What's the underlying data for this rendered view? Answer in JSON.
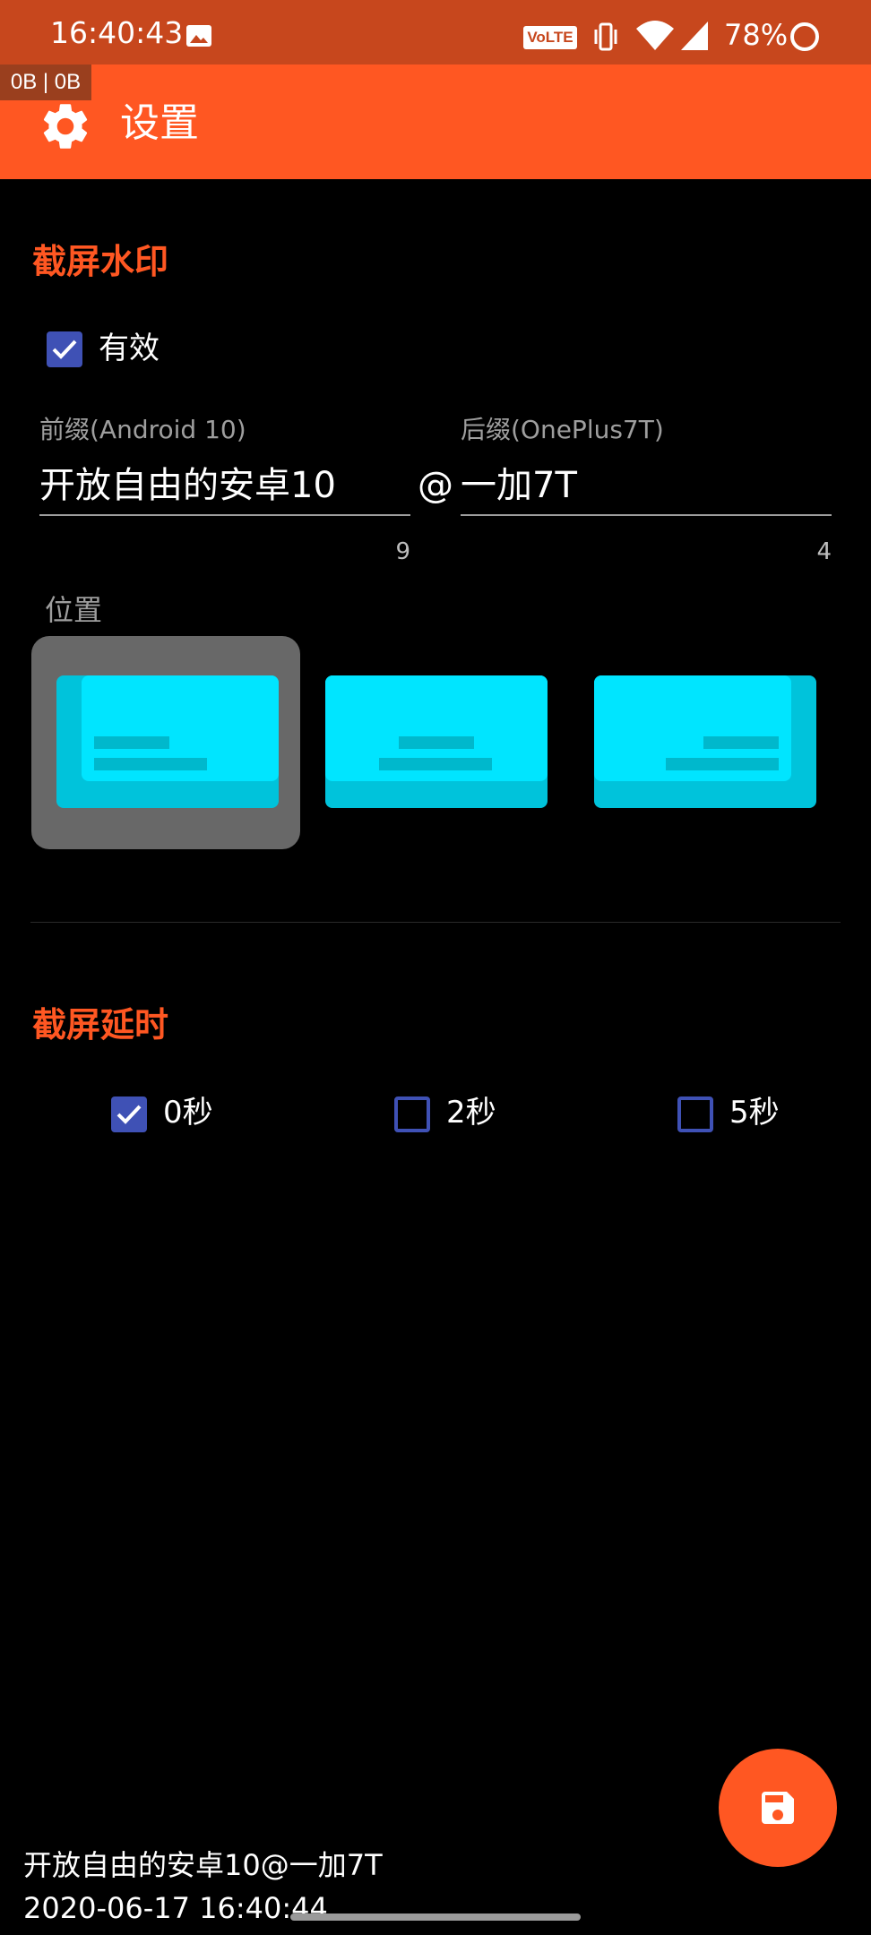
{
  "status_bar": {
    "time": "16:40:43",
    "volte": "VoLTE",
    "battery": "78%",
    "icons": [
      "image-icon",
      "vibrate-icon",
      "wifi-icon",
      "signal-icon",
      "battery-ring-icon"
    ]
  },
  "traffic_overlay": "0B | 0B",
  "app_bar": {
    "title": "设置",
    "icon": "gear-icon"
  },
  "watermark_section": {
    "title": "截屏水印",
    "enabled": {
      "label": "有效",
      "checked": true
    },
    "prefix": {
      "label": "前缀(Android 10)",
      "value": "开放自由的安卓10",
      "counter": "9"
    },
    "separator": "@",
    "suffix": {
      "label": "后缀(OnePlus7T)",
      "value": "一加7T",
      "counter": "4"
    },
    "position": {
      "label": "位置",
      "options": [
        "left",
        "center",
        "right"
      ],
      "selected": "left"
    }
  },
  "delay_section": {
    "title": "截屏延时",
    "options": [
      {
        "label": "0秒",
        "checked": true
      },
      {
        "label": "2秒",
        "checked": false
      },
      {
        "label": "5秒",
        "checked": false
      }
    ]
  },
  "fab": {
    "icon": "save-icon"
  },
  "watermark_preview": {
    "line1": "开放自由的安卓10@一加7T",
    "line2": "2020-06-17  16:40:44"
  },
  "colors": {
    "accent": "#ff5722",
    "status_bar": "#c7471d",
    "checkbox": "#3f51b5",
    "preview_card": "#00e5ff"
  }
}
